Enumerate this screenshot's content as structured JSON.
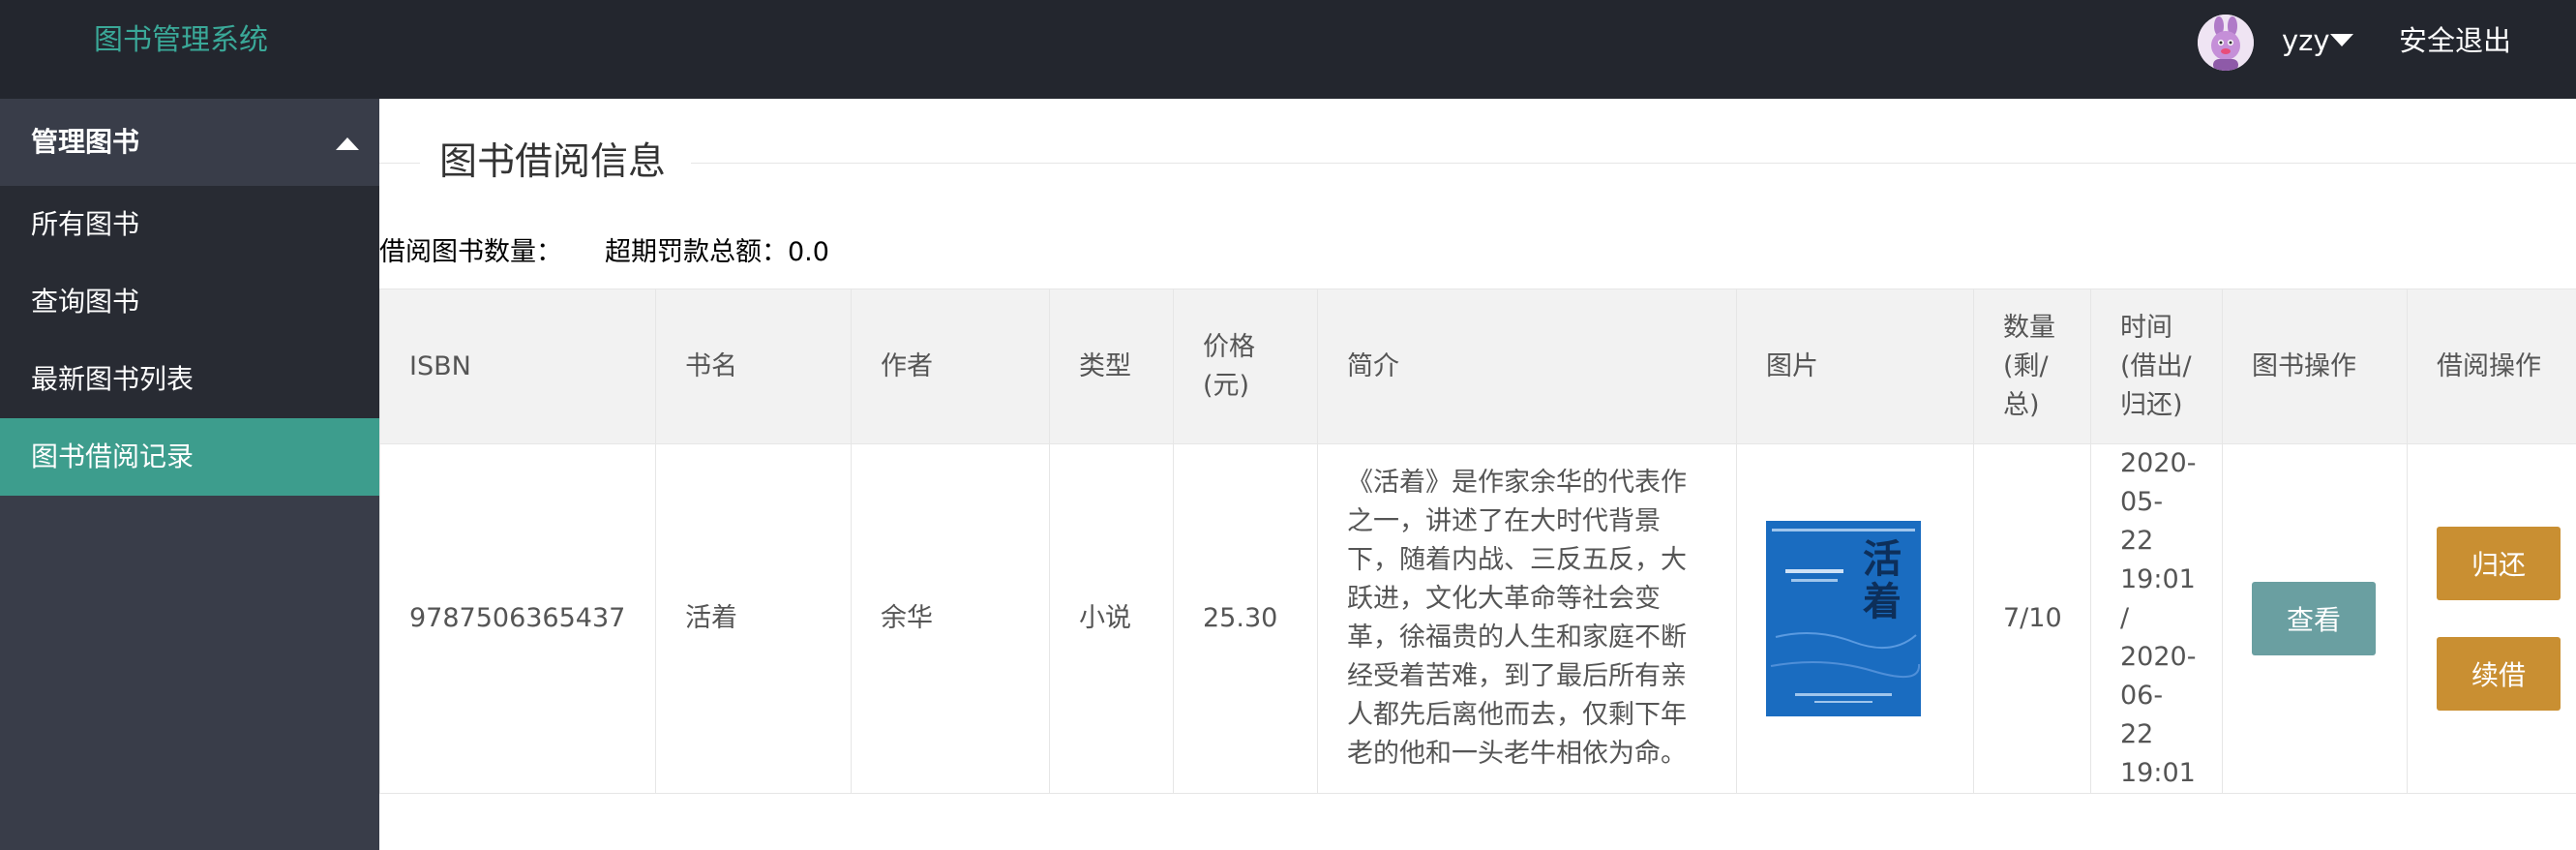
{
  "header": {
    "app_title": "图书管理系统",
    "username": "yzy",
    "logout_label": "安全退出"
  },
  "sidebar": {
    "group_label": "管理图书",
    "items": [
      {
        "label": "所有图书",
        "active": false
      },
      {
        "label": "查询图书",
        "active": false
      },
      {
        "label": "最新图书列表",
        "active": false
      },
      {
        "label": "图书借阅记录",
        "active": true
      }
    ]
  },
  "main": {
    "section_title": "图书借阅信息",
    "borrow_count_label": "借阅图书数量：",
    "borrow_count_value": "",
    "fine_label": "超期罚款总额：",
    "fine_value": "0.0",
    "table": {
      "columns": [
        "ISBN",
        "书名",
        "作者",
        "类型",
        "价格(元)",
        "简介",
        "图片",
        "数量(剩/总)",
        "时间(借出/归还)",
        "图书操作",
        "借阅操作"
      ],
      "rows": [
        {
          "isbn": "9787506365437",
          "title": "活着",
          "author": "余华",
          "type": "小说",
          "price": "25.30",
          "intro": "《活着》是作家余华的代表作之一，讲述了在大时代背景下，随着内战、三反五反，大跃进，文化大革命等社会变革，徐福贵的人生和家庭不断经受着苦难，到了最后所有亲人都先后离他而去，仅剩下年老的他和一头老牛相依为命。",
          "cover_title": "活着",
          "quantity": "7/10",
          "borrow_time": "2020-05-22 19:01",
          "separator": "/",
          "return_time": "2020-06-22 19:01",
          "view_label": "查看",
          "return_label": "归还",
          "renew_label": "续借"
        }
      ]
    }
  },
  "colors": {
    "header_bg": "#23262e",
    "sidebar_bg": "#393d49",
    "sidebar_sub_bg": "#282b33",
    "accent": "#3d9d8d",
    "view_button": "#6a9fa1",
    "action_button": "#c98f32"
  },
  "icons": {
    "user_menu_toggle": "caret-down-icon",
    "sidebar_group_toggle": "caret-up-icon"
  }
}
